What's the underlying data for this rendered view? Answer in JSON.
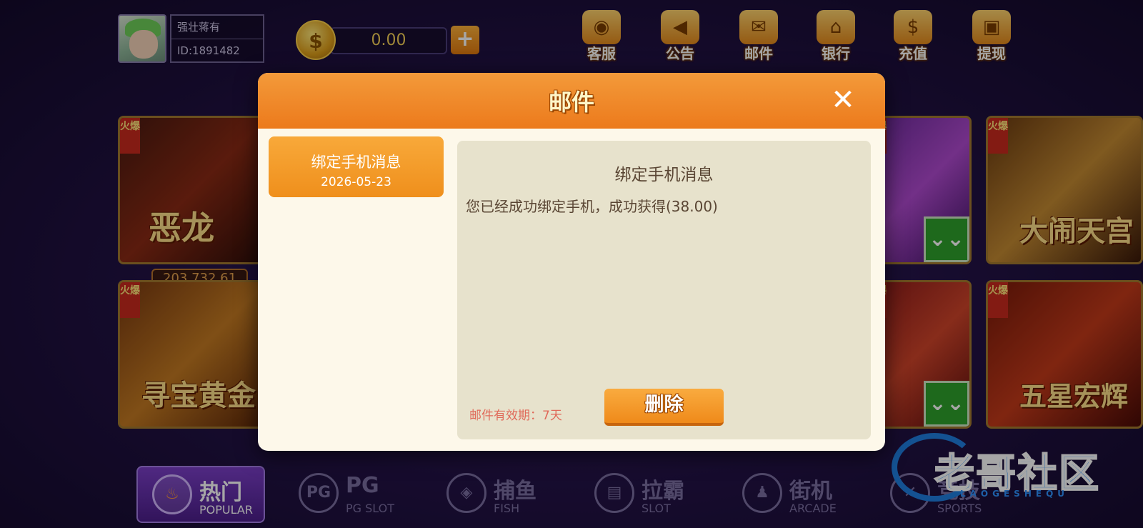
{
  "user": {
    "name": "强壮蒋有",
    "id": "ID:1891482"
  },
  "wallet": {
    "coin_symbol": "$",
    "balance": "0.00",
    "add_label": "+"
  },
  "top_menu": [
    {
      "label": "客服",
      "icon": "robot-icon"
    },
    {
      "label": "公告",
      "icon": "megaphone-icon"
    },
    {
      "label": "邮件",
      "icon": "mail-icon"
    },
    {
      "label": "银行",
      "icon": "bank-icon"
    },
    {
      "label": "充值",
      "icon": "recharge-icon"
    },
    {
      "label": "提现",
      "icon": "wallet-icon"
    }
  ],
  "games": [
    {
      "tag": "火爆",
      "name": "恶龙"
    },
    {
      "tag": "火爆",
      "name": "寻宝黄金"
    },
    {
      "tag": "火爆",
      "name": "大闹天宫"
    },
    {
      "tag": "火爆",
      "name": "五星宏辉"
    },
    {
      "tag": "火爆",
      "name": ""
    },
    {
      "tag": "火爆",
      "name": ""
    }
  ],
  "jackpots": [
    "203,732.61"
  ],
  "bottom_nav": [
    {
      "label": "热门",
      "sub": "POPULAR",
      "icon": "flame-icon",
      "active": true
    },
    {
      "label": "PG",
      "sub": "PG SLOT",
      "icon": "pg-icon",
      "active": false
    },
    {
      "label": "捕鱼",
      "sub": "FISH",
      "icon": "fish-icon",
      "active": false
    },
    {
      "label": "拉霸",
      "sub": "SLOT",
      "icon": "slot-machine-icon",
      "active": false
    },
    {
      "label": "街机",
      "sub": "ARCADE",
      "icon": "joystick-icon",
      "active": false
    },
    {
      "label": "竞技",
      "sub": "SPORTS",
      "icon": "sports-icon",
      "active": false
    }
  ],
  "watermark": {
    "text": "老哥社区",
    "sub": "LAOGESHEQU"
  },
  "dialog": {
    "title": "邮件",
    "close_label": "✕",
    "mail_list": [
      {
        "title": "绑定手机消息",
        "date": "2026-05-23"
      }
    ],
    "message": {
      "title": "绑定手机消息",
      "body": "您已经成功绑定手机，成功获得(38.00)",
      "expiry": "邮件有效期：7天",
      "delete_label": "删除"
    }
  },
  "colors": {
    "accent_orange": "#ef8f1c",
    "panel_bg": "#e7e2cc",
    "dialog_bg": "#fdf8ea",
    "expiry_red": "#e06a5a",
    "text_brown": "#5a4634"
  }
}
